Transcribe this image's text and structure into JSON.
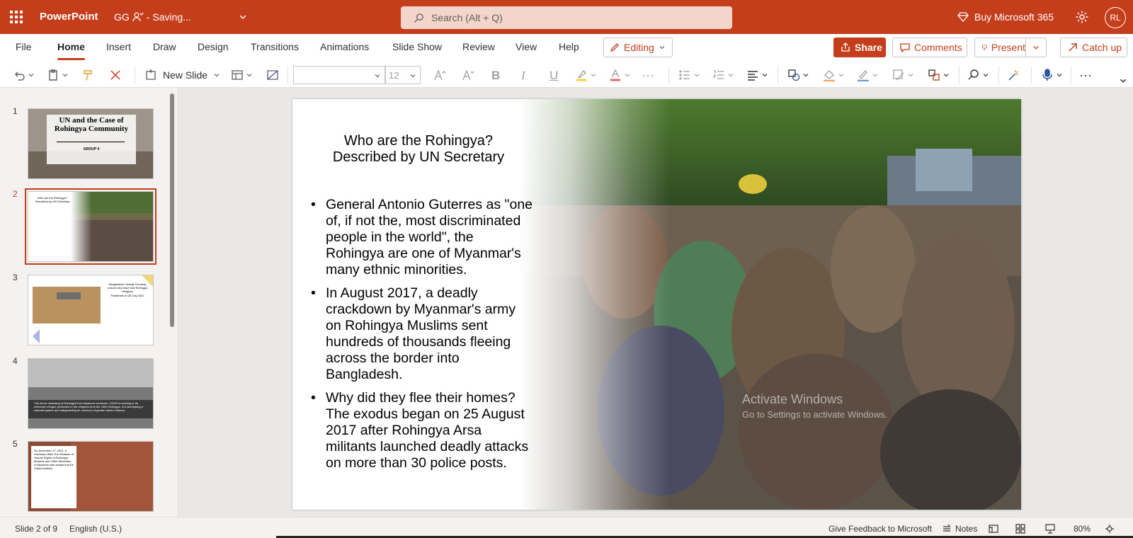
{
  "titlebar": {
    "app_name": "PowerPoint",
    "doc_name": "GG",
    "save_status": "- Saving...",
    "search_placeholder": "Search (Alt + Q)",
    "buy_label": "Buy Microsoft 365",
    "avatar_initials": "RL"
  },
  "ribbon": {
    "tabs": [
      "File",
      "Home",
      "Insert",
      "Draw",
      "Design",
      "Transitions",
      "Animations",
      "Slide Show",
      "Review",
      "View",
      "Help"
    ],
    "active_tab": "Home",
    "editing_label": "Editing",
    "share_label": "Share",
    "comments_label": "Comments",
    "present_label": "Present",
    "catchup_label": "Catch up"
  },
  "toolbar": {
    "new_slide_label": "New Slide",
    "font_name": "",
    "font_size": "12",
    "bold": "B",
    "italic": "I",
    "underline": "U"
  },
  "thumbnails": [
    {
      "number": "1",
      "title": "UN and the Case of Rohingya Community",
      "subtitle": "GROUP 4"
    },
    {
      "number": "2",
      "title": "Who are the Rohingya? Described by UN Secretary"
    },
    {
      "number": "3",
      "title": "Bangladesh: Deadly Flooding Leaves who have told Rohingya refugees",
      "subtitle": "Published on 28 July 2021"
    },
    {
      "number": "4",
      "caption": "The ethnic cleansing of Rohingya from Myanmar continues. OHCR is working to an extensive refugee protection in the refugees from the 1000 Rohingya. It is developing a national system and safeguarding for survivors of gender based violence"
    },
    {
      "number": "5",
      "caption": "On November 17, 2021, a resolution titled The Situation of Human Rights of Rohingya Muslims and Other Minorities in Myanmar was adopted at the United Nations"
    }
  ],
  "slide": {
    "title": "Who are the Rohingya? Described by UN Secretary",
    "bullets": [
      "General Antonio Guterres as \"one of, if not the, most discriminated people in the world\", the Rohingya are one of Myanmar's many ethnic minorities.",
      "In August 2017, a deadly crackdown by Myanmar's army on Rohingya Muslims sent hundreds of thousands fleeing across the border into Bangladesh.",
      "Why did they flee their homes? The exodus began on 25 August 2017 after Rohingya Arsa militants launched deadly attacks on more than 30 police posts."
    ]
  },
  "watermark": {
    "line1": "Activate Windows",
    "line2": "Go to Settings to activate Windows."
  },
  "statusbar": {
    "slide_indicator": "Slide 2 of 9",
    "language": "English (U.S.)",
    "feedback": "Give Feedback to Microsoft",
    "notes": "Notes",
    "zoom": "80%"
  },
  "colors": {
    "accent": "#c43e1c",
    "canvas": "#e9e8e7"
  }
}
